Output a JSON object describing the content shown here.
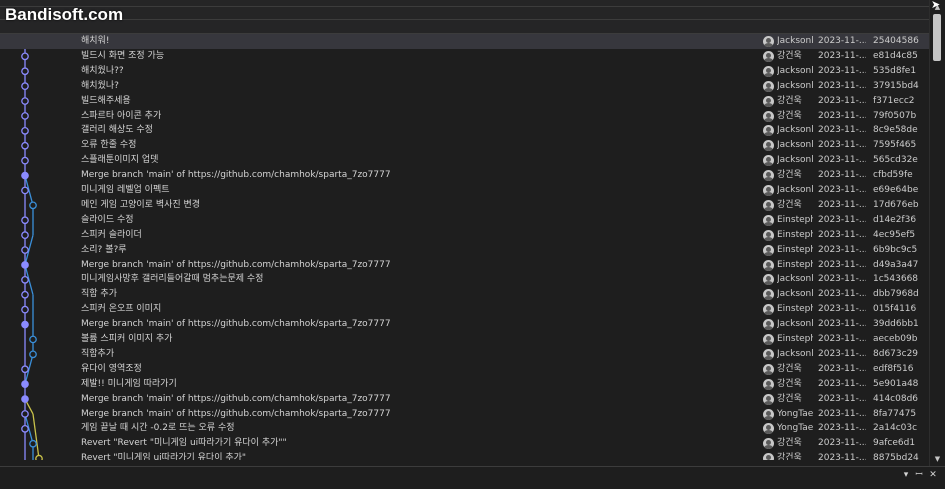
{
  "watermark": {
    "text": "Bandisoft.com"
  },
  "commits": [
    {
      "message": "해치워!",
      "author": "Jacksonl",
      "date": "2023-11-...",
      "hash": "25404586",
      "selected": true
    },
    {
      "message": "빌드시 화면 조정 가능",
      "author": "강건욱",
      "date": "2023-11-...",
      "hash": "e81d4c85"
    },
    {
      "message": "해치웠나??",
      "author": "Jacksonl",
      "date": "2023-11-...",
      "hash": "535d8fe1"
    },
    {
      "message": "해치웠나?",
      "author": "Jacksonl",
      "date": "2023-11-...",
      "hash": "37915bd4"
    },
    {
      "message": "빌드해주세용",
      "author": "강건욱",
      "date": "2023-11-...",
      "hash": "f371ecc2"
    },
    {
      "message": "스파르타 아이콘 추가",
      "author": "강건욱",
      "date": "2023-11-...",
      "hash": "79f0507b"
    },
    {
      "message": "갤러리 해상도 수정",
      "author": "Jacksonl",
      "date": "2023-11-...",
      "hash": "8c9e58de"
    },
    {
      "message": "오류 한줄 수정",
      "author": "Jacksonl",
      "date": "2023-11-...",
      "hash": "7595f465"
    },
    {
      "message": "스플래툰이미지 업뎃",
      "author": "Jacksonl",
      "date": "2023-11-...",
      "hash": "565cd32e"
    },
    {
      "message": "Merge branch 'main' of https://github.com/chamhok/sparta_7zo7777",
      "author": "강건욱",
      "date": "2023-11-...",
      "hash": "cfbd59fe"
    },
    {
      "message": "미니게임 레벨업 이펙트",
      "author": "Jacksonl",
      "date": "2023-11-...",
      "hash": "e69e64be"
    },
    {
      "message": "메인 게임 고양이로 벽사진 변경",
      "author": "강건욱",
      "date": "2023-11-...",
      "hash": "17d676eb"
    },
    {
      "message": "슬라이드 수정",
      "author": "Einsteph",
      "date": "2023-11-...",
      "hash": "d14e2f36"
    },
    {
      "message": "스피커 슬라이더",
      "author": "Einsteph",
      "date": "2023-11-...",
      "hash": "4ec95ef5"
    },
    {
      "message": "소리? 볼?루",
      "author": "Einsteph",
      "date": "2023-11-...",
      "hash": "6b9bc9c5"
    },
    {
      "message": "Merge branch 'main' of https://github.com/chamhok/sparta_7zo7777",
      "author": "Einsteph",
      "date": "2023-11-...",
      "hash": "d49a3a47"
    },
    {
      "message": "미니게임사망후 갤러리들어갈때 멈추는문제 수정",
      "author": "Jacksonl",
      "date": "2023-11-...",
      "hash": "1c543668"
    },
    {
      "message": "직함 추가",
      "author": "Jacksonl",
      "date": "2023-11-...",
      "hash": "dbb7968d"
    },
    {
      "message": "스피커 온오프 이미지",
      "author": "Einsteph",
      "date": "2023-11-...",
      "hash": "015f4116"
    },
    {
      "message": "Merge branch 'main' of https://github.com/chamhok/sparta_7zo7777",
      "author": "Jacksonl",
      "date": "2023-11-...",
      "hash": "39dd6bb1"
    },
    {
      "message": "볼륨 스피커 이미지 추가",
      "author": "Einsteph",
      "date": "2023-11-...",
      "hash": "aeceb09b"
    },
    {
      "message": "직함추가",
      "author": "Jacksonl",
      "date": "2023-11-...",
      "hash": "8d673c29"
    },
    {
      "message": "유다이 영역조정",
      "author": "강건욱",
      "date": "2023-11-...",
      "hash": "edf8f516"
    },
    {
      "message": "제발!! 미니게임 따라가기",
      "author": "강건욱",
      "date": "2023-11-...",
      "hash": "5e901a48"
    },
    {
      "message": "Merge branch 'main' of https://github.com/chamhok/sparta_7zo7777",
      "author": "강건욱",
      "date": "2023-11-...",
      "hash": "414c08d6"
    },
    {
      "message": "Merge branch 'main' of https://github.com/chamhok/sparta_7zo7777",
      "author": "YongTae",
      "date": "2023-11-...",
      "hash": "8fa77475"
    },
    {
      "message": "게임 끝날 때 시간 -0.2로 뜨는 오류 수정",
      "author": "YongTae",
      "date": "2023-11-...",
      "hash": "2a14c03c"
    },
    {
      "message": "Revert \"Revert \"미니게임 ui따라가기 유다이 추가\"\"",
      "author": "강건욱",
      "date": "2023-11-...",
      "hash": "9afce6d1"
    },
    {
      "message": "Revert \"미니게임 ui따라가기 유다이 추가\"",
      "author": "강건욱",
      "date": "2023-11-...",
      "hash": "8875bd24"
    }
  ],
  "colors": {
    "main_lane": "#8b8bff",
    "branch_lane": "#3a8fd9",
    "side_lane": "#c9c24a",
    "selected_row": "#37373d"
  },
  "icons": {
    "scroll_up": "chevron-up-icon",
    "scroll_down": "chevron-down-icon",
    "dropdown": "dropdown-icon",
    "pin": "pin-icon",
    "close": "close-icon"
  },
  "bottombar": {
    "dropdown_glyph": "▾",
    "pin_glyph": "ꟷ",
    "close_glyph": "✕"
  }
}
